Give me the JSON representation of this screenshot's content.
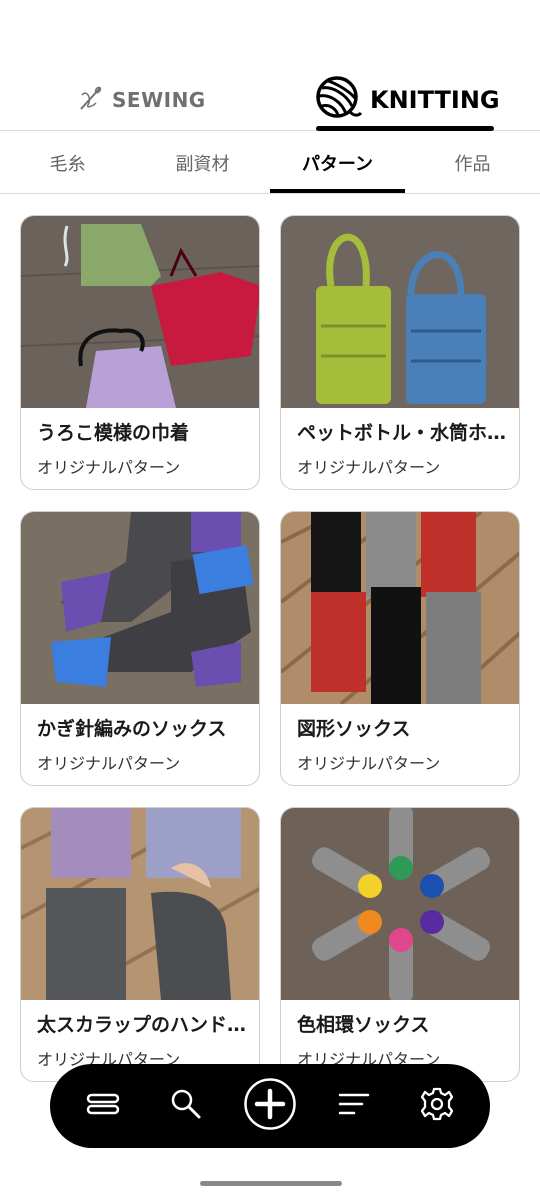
{
  "mode_tabs": [
    {
      "label": "SEWING",
      "icon": "needle-thread-icon",
      "active": false
    },
    {
      "label": "KNITTING",
      "icon": "yarn-ball-icon",
      "active": true
    }
  ],
  "sub_tabs": [
    {
      "label": "毛糸",
      "active": false
    },
    {
      "label": "副資材",
      "active": false
    },
    {
      "label": "パターン",
      "active": true
    },
    {
      "label": "作品",
      "active": false
    }
  ],
  "cards": [
    {
      "title": "うろこ模様の巾着",
      "subtitle": "オリジナルパターン"
    },
    {
      "title": "ペットボトル・水筒ホルダー",
      "subtitle": "オリジナルパターン"
    },
    {
      "title": "かぎ針編みのソックス",
      "subtitle": "オリジナルパターン"
    },
    {
      "title": "図形ソックス",
      "subtitle": "オリジナルパターン"
    },
    {
      "title": "太スカラップのハンドウォーマー",
      "subtitle": "オリジナルパターン"
    },
    {
      "title": "色相環ソックス",
      "subtitle": "オリジナルパターン"
    }
  ],
  "bottom_nav": [
    {
      "icon": "menu-icon"
    },
    {
      "icon": "search-icon"
    },
    {
      "icon": "add-icon"
    },
    {
      "icon": "sort-icon"
    },
    {
      "icon": "settings-icon"
    }
  ],
  "colors": {
    "accent": "#000000",
    "inactive": "#707070",
    "divider": "#d9d9d9"
  }
}
